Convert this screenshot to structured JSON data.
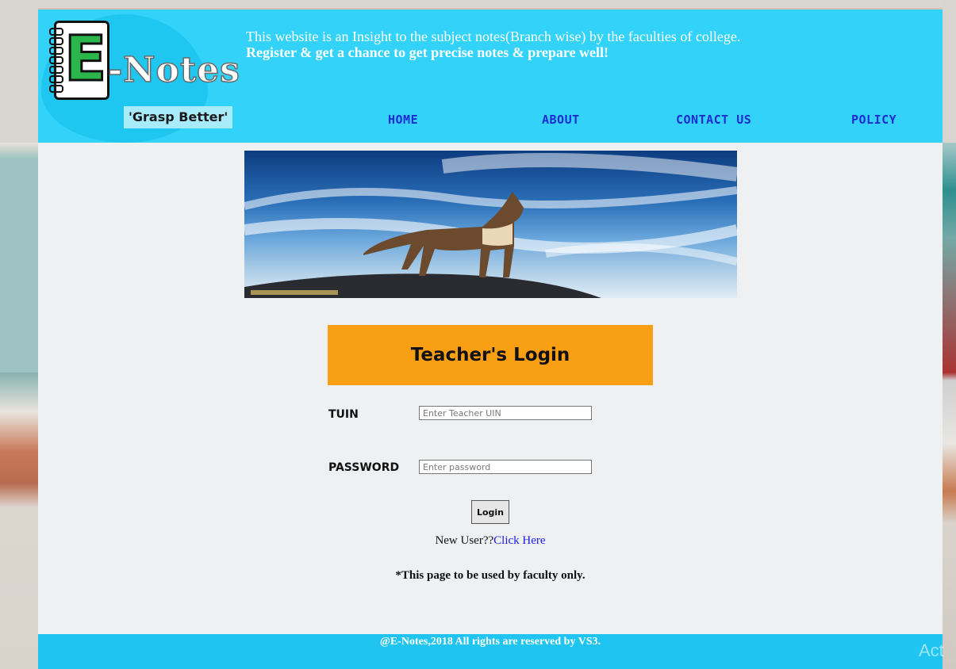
{
  "logo": {
    "letter": "E",
    "name": "-Notes",
    "tagline": "'Grasp Better'"
  },
  "intro": {
    "line1": "This website is an Insight to the subject notes(Branch wise) by the faculties of college.",
    "line2": "Register & get a chance to get precise notes & prepare well!"
  },
  "nav": [
    {
      "label": "HOME"
    },
    {
      "label": "ABOUT"
    },
    {
      "label": "CONTACT US"
    },
    {
      "label": "POLICY"
    }
  ],
  "login": {
    "title": "Teacher's Login",
    "tuin_label": "TUIN",
    "tuin_placeholder": "Enter Teacher UIN",
    "password_label": "PASSWORD",
    "password_placeholder": "Enter password",
    "button": "Login",
    "new_user_text": "New User??",
    "new_user_link": "Click Here",
    "note": "*This page to be used by faculty only."
  },
  "footer": {
    "text": "@E-Notes,2018 All rights are reserved by VS3."
  },
  "watermark": "Act",
  "colors": {
    "header": "#33d3f9",
    "nav_link": "#1b2bd6",
    "login_title_bg": "#f99f14",
    "footer": "#1fc5f0",
    "link": "#1a1ae8"
  },
  "icons": [
    "notebook-logo-icon"
  ]
}
